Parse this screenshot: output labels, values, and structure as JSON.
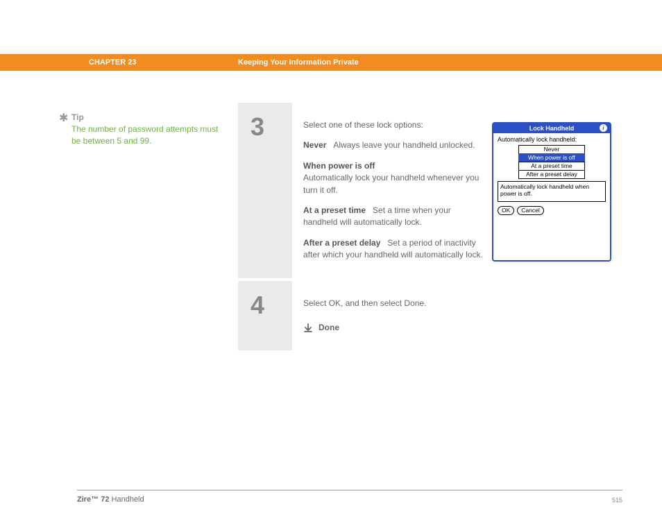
{
  "header": {
    "chapter": "CHAPTER 23",
    "title": "Keeping Your Information Private"
  },
  "tip": {
    "label": "Tip",
    "text": "The number of password attempts must be between 5 and 99."
  },
  "steps": {
    "s3": {
      "num": "3",
      "intro": "Select one of these lock options:",
      "never_label": "Never",
      "never_desc": "Always leave your handheld unlocked.",
      "power_label": "When power is off",
      "power_desc": "Automatically lock your handheld whenever you turn it off.",
      "preset_time_label": "At a preset time",
      "preset_time_desc": "Set a time when your handheld will automatically lock.",
      "preset_delay_label": "After a preset delay",
      "preset_delay_desc": "Set a period of inactivity after which your handheld will automatically lock."
    },
    "s4": {
      "num": "4",
      "text": "Select OK, and then select Done.",
      "done": "Done"
    }
  },
  "dialog": {
    "title": "Lock Handheld",
    "label": "Automatically lock handheld:",
    "opt_never": "Never",
    "opt_power": "When power is off",
    "opt_time": "At a preset time",
    "opt_delay": "After a preset delay",
    "desc": "Automatically lock handheld when power is off.",
    "ok": "OK",
    "cancel": "Cancel"
  },
  "footer": {
    "product_bold": "Zire™ 72",
    "product_rest": " Handheld",
    "page": "515"
  }
}
